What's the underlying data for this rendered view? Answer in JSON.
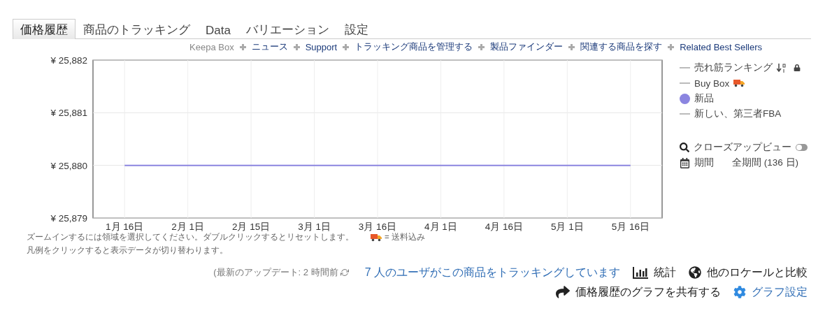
{
  "tabs": [
    {
      "label": "価格履歴",
      "selected": true
    },
    {
      "label": "商品のトラッキング",
      "selected": false
    },
    {
      "label": "Data",
      "selected": false
    },
    {
      "label": "バリエーション",
      "selected": false
    },
    {
      "label": "設定",
      "selected": false
    }
  ],
  "links": [
    {
      "label": "Keepa Box",
      "selected": true
    },
    {
      "label": "ニュース",
      "selected": false
    },
    {
      "label": "Support",
      "selected": false
    },
    {
      "label": "トラッキング商品を管理する",
      "selected": false
    },
    {
      "label": "製品ファインダー",
      "selected": false
    },
    {
      "label": "関連する商品を探す",
      "selected": false
    },
    {
      "label": "Related Best Sellers",
      "selected": false
    }
  ],
  "chart_data": {
    "type": "line",
    "grid": true,
    "categories": [
      "1月 16日",
      "2月 1日",
      "2月 15日",
      "3月 1日",
      "3月 16日",
      "4月 1日",
      "4月 16日",
      "5月 1日",
      "5月 16日"
    ],
    "ylim": [
      25879,
      25882
    ],
    "yticks": [
      {
        "value": 25879,
        "label": "¥ 25,879"
      },
      {
        "value": 25880,
        "label": "¥ 25,880"
      },
      {
        "value": 25881,
        "label": "¥ 25,881"
      },
      {
        "value": 25882,
        "label": "¥ 25,882"
      }
    ],
    "series": [
      {
        "name": "新品",
        "color": "#8b85e0",
        "values": [
          25880,
          25880,
          25880,
          25880,
          25880,
          25880,
          25880,
          25880,
          25880
        ]
      }
    ]
  },
  "legend": [
    {
      "label": "売れ筋ランキング",
      "kind": "ranking",
      "visible": false
    },
    {
      "label": "Buy Box",
      "kind": "buybox",
      "visible": false
    },
    {
      "kind": "chart_series",
      "visible": true
    },
    {
      "label": "新しい、第三者FBA",
      "kind": "series",
      "visible": false
    }
  ],
  "closeup": {
    "label": "クローズアップビュー",
    "on": false
  },
  "period": {
    "label": "期間",
    "value": "全期間 (136 日)"
  },
  "notes": {
    "zoom": "ズームインするには領域を選択してください。ダブルクリックするとリセットします。",
    "shipping": "= 送料込み",
    "legend": "凡例をクリックすると表示データが切り替わります。"
  },
  "footer": {
    "update": "(最新のアップデート: 2 時間前",
    "tracking": "7 人のユーザがこの商品をトラッキングしています",
    "stats": "統計",
    "compare": "他のロケールと比較",
    "share": "価格履歴のグラフを共有する",
    "settings": "グラフ設定"
  }
}
